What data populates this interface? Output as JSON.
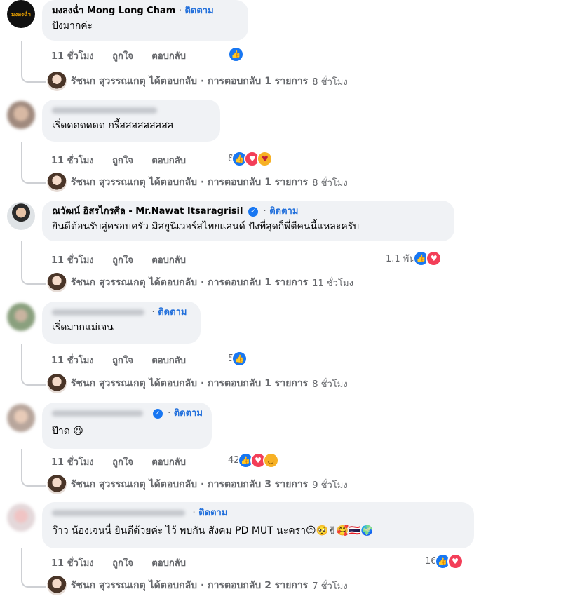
{
  "labels": {
    "follow": "ติดตาม",
    "separator": "·",
    "like": "ถูกใจ",
    "reply": "ตอบกลับ"
  },
  "comments": [
    {
      "author": "มงลงฉ่ำ Mong Long Cham",
      "avatar_text": "มงลงฉ่ำ",
      "text": "ปังมากค่ะ",
      "time": "11 ชั่วโมง",
      "reaction_count": "",
      "reactions": [
        "like"
      ],
      "reply_summary": "รัชนก สุวรรณเกตุ ได้ตอบกลับ · การตอบกลับ 1 รายการ",
      "reply_time": "8 ชั่วโมง"
    },
    {
      "author": "",
      "text": "เริ่ดดดดดดด กรี้สสสสสสสสส",
      "time": "11 ชั่วโมง",
      "reaction_count": "8",
      "reactions": [
        "like",
        "love",
        "care"
      ],
      "reply_summary": "รัชนก สุวรรณเกตุ ได้ตอบกลับ · การตอบกลับ 1 รายการ",
      "reply_time": "8 ชั่วโมง"
    },
    {
      "author": "ณวัฒน์ อิสรไกรศีล - Mr.Nawat Itsaragrisil",
      "text": "ยินดีต้อนรับสู่ครอบครัว มิสยูนิเวอร์สไทยแลนด์ ปังที่สุดก็พี่ตีคนนี้แหละครับ",
      "time": "11 ชั่วโมง",
      "reaction_count": "1.1 พัน",
      "reactions": [
        "like",
        "love"
      ],
      "reply_summary": "รัชนก สุวรรณเกตุ ได้ตอบกลับ · การตอบกลับ 1 รายการ",
      "reply_time": "11 ชั่วโมง"
    },
    {
      "author": "",
      "text": "เริ่ดมากแม่เจน",
      "time": "11 ชั่วโมง",
      "reaction_count": "5",
      "reactions": [
        "like"
      ],
      "reply_summary": "รัชนก สุวรรณเกตุ ได้ตอบกลับ · การตอบกลับ 1 รายการ",
      "reply_time": "8 ชั่วโมง"
    },
    {
      "author": "",
      "text": "ป๊าด 😆",
      "time": "11 ชั่วโมง",
      "reaction_count": "42",
      "reactions": [
        "like",
        "love",
        "haha"
      ],
      "reply_summary": "รัชนก สุวรรณเกตุ ได้ตอบกลับ · การตอบกลับ 3 รายการ",
      "reply_time": "9 ชั่วโมง"
    },
    {
      "author": "",
      "text": "ว๊าว น้องเจนนี่ ยินดีด้วยค่ะ ไว้ พบกัน สังคม PD MUT นะคร่า😌🥺✌🥰🇹🇭🌍",
      "time": "11 ชั่วโมง",
      "reaction_count": "16",
      "reactions": [
        "like",
        "love"
      ],
      "reply_summary": "รัชนก สุวรรณเกตุ ได้ตอบกลับ · การตอบกลับ 2 รายการ",
      "reply_time": "7 ชั่วโมง"
    }
  ],
  "colors": {
    "link": "#216fdb",
    "bubble": "#f0f2f5",
    "meta": "#65676b",
    "like": "#1877f2",
    "love": "#f33e58"
  }
}
